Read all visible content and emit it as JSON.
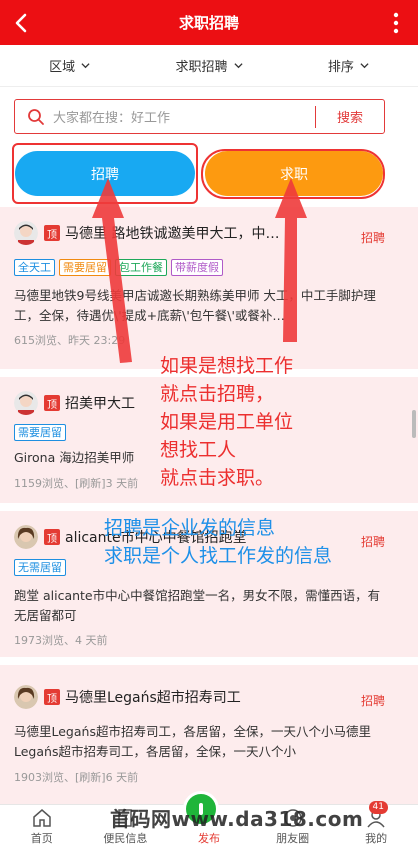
{
  "header": {
    "title": "求职招聘"
  },
  "filters": [
    {
      "label": "区域"
    },
    {
      "label": "求职招聘"
    },
    {
      "label": "排序"
    }
  ],
  "search": {
    "placeholder": "大家都在搜：好工作",
    "button": "搜索"
  },
  "buttons": {
    "recruit": "招聘",
    "job_seek": "求职"
  },
  "items": [
    {
      "title": "马德里 路地铁诚邀美甲大工，中…",
      "type": "招聘",
      "tags": [
        {
          "text": "全天工",
          "color": "blue"
        },
        {
          "text": "需要居留",
          "color": "orange"
        },
        {
          "text": "包工作餐",
          "color": "green"
        },
        {
          "text": "带薪度假",
          "color": "purple"
        }
      ],
      "desc": "马德里地铁9号线美甲店诚邀长期熟练美甲师 大工，中工手脚护理工，全保，待遇优\\'提成+底薪\\'包午餐\\'或餐补…",
      "meta": "615浏览、昨天 23:29"
    },
    {
      "title": "招美甲大工",
      "type": "",
      "tags": [
        {
          "text": "需要居留",
          "color": "blue"
        }
      ],
      "desc": "Girona 海边招美甲师",
      "meta": "1159浏览、[刷新]3 天前"
    },
    {
      "title": "alicante市中心中餐馆招跑堂",
      "type": "招聘",
      "tags": [
        {
          "text": "无需居留",
          "color": "blue"
        }
      ],
      "desc": "跑堂 alicante市中心中餐馆招跑堂一名，男女不限，需懂西语，有无居留都可",
      "meta": "1973浏览、4 天前"
    },
    {
      "title": "马德里Legańs超市招寿司工",
      "type": "招聘",
      "tags": [],
      "desc": "马德里Legańs超市招寿司工，各居留，全保，一天八个小马德里Legańs超市招寿司工，各居留，全保，一天八个小",
      "meta": "1903浏览、[刷新]6 天前"
    }
  ],
  "ding_label": "顶",
  "annotations": {
    "red_lines": [
      "如果是想找工作",
      "就点击招聘，",
      "如果是用工单位",
      "想找工人",
      "就点击求职。"
    ],
    "blue_lines": [
      "招聘是企业发的信息",
      "求职是个人找工作发的信息"
    ]
  },
  "bottom_nav": [
    {
      "label": "首页"
    },
    {
      "label": "便民信息"
    },
    {
      "label": "发布"
    },
    {
      "label": "朋友圈"
    },
    {
      "label": "我的",
      "badge": "41"
    }
  ],
  "watermark": "首码网www.da318.com",
  "colors": {
    "header": "#ec0f13",
    "recruit": "#18a9f2",
    "job_seek": "#fd9a10",
    "accent": "#e43b33"
  }
}
